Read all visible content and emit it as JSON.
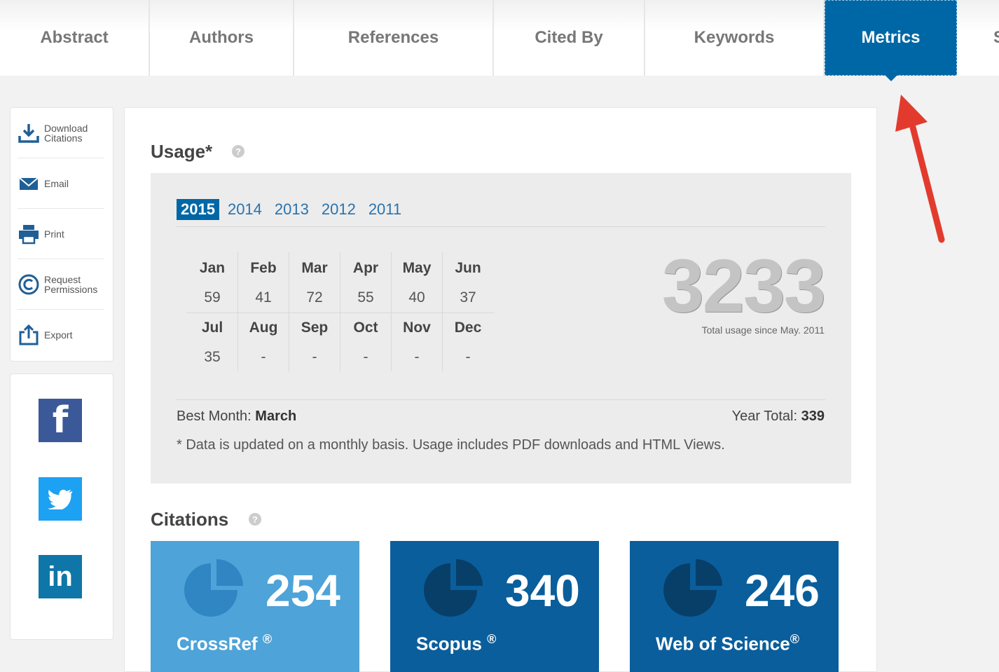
{
  "tabs": [
    {
      "label": "Abstract"
    },
    {
      "label": "Authors"
    },
    {
      "label": "References"
    },
    {
      "label": "Cited By"
    },
    {
      "label": "Keywords"
    },
    {
      "label": "Metrics"
    },
    {
      "label": "S"
    }
  ],
  "active_tab": "Metrics",
  "tools": [
    {
      "label_line1": "Download",
      "label_line2": "Citations",
      "icon": "download-icon"
    },
    {
      "label_line1": "Email",
      "label_line2": "",
      "icon": "email-icon"
    },
    {
      "label_line1": "Print",
      "label_line2": "",
      "icon": "print-icon"
    },
    {
      "label_line1": "Request",
      "label_line2": "Permissions",
      "icon": "copyright-icon"
    },
    {
      "label_line1": "Export",
      "label_line2": "",
      "icon": "export-icon"
    }
  ],
  "social": [
    {
      "name": "facebook",
      "glyph": "f",
      "color": "#3b5998"
    },
    {
      "name": "twitter",
      "glyph": "",
      "color": "#1da1f2"
    },
    {
      "name": "linkedin",
      "glyph": "in",
      "color": "#0e76a8"
    }
  ],
  "usage": {
    "title": "Usage*",
    "years": [
      "2015",
      "2014",
      "2013",
      "2012",
      "2011"
    ],
    "selected_year": "2015",
    "months_row1": [
      "Jan",
      "Feb",
      "Mar",
      "Apr",
      "May",
      "Jun"
    ],
    "values_row1": [
      "59",
      "41",
      "72",
      "55",
      "40",
      "37"
    ],
    "months_row2": [
      "Jul",
      "Aug",
      "Sep",
      "Oct",
      "Nov",
      "Dec"
    ],
    "values_row2": [
      "35",
      "-",
      "-",
      "-",
      "-",
      "-"
    ],
    "total": "3233",
    "total_caption": "Total usage since May. 2011",
    "best_month_label": "Best Month:",
    "best_month": "March",
    "year_total_label": "Year Total:",
    "year_total": "339",
    "note": "* Data is updated on a monthly basis. Usage includes PDF downloads and HTML Views."
  },
  "citations": {
    "title": "Citations",
    "items": [
      {
        "count": "254",
        "source": "CrossRef",
        "mark": "®",
        "color": "#4ea3d8",
        "pie_color": "#2f86c3"
      },
      {
        "count": "340",
        "source": "Scopus",
        "mark": "®",
        "color": "#0a5e9c",
        "pie_color": "#073f69"
      },
      {
        "count": "246",
        "source": "Web of Science",
        "mark": "®",
        "color": "#0a5e9c",
        "pie_color": "#073f69"
      }
    ]
  },
  "colors": {
    "accent": "#0067a6",
    "arrow": "#e23b2e"
  }
}
